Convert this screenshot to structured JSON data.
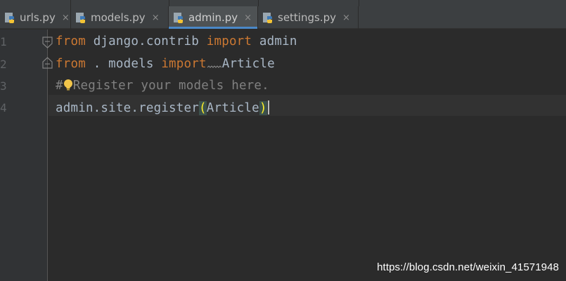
{
  "tabs": [
    {
      "label": "urls.py",
      "active": false
    },
    {
      "label": "models.py",
      "active": false
    },
    {
      "label": "admin.py",
      "active": true
    },
    {
      "label": "settings.py",
      "active": false
    }
  ],
  "tab_close_glyph": "×",
  "line_numbers": [
    "1",
    "2",
    "3",
    "4"
  ],
  "code": {
    "line1": {
      "kw1": "from",
      "mod": " django.contrib ",
      "kw2": "import",
      "name": " admin"
    },
    "line2": {
      "kw1": "from",
      "mod": " . models ",
      "kw2": "import",
      "name": "Article"
    },
    "line3": {
      "hash": "#",
      "comment": "Register your models here."
    },
    "line4": {
      "call": "admin.site.register",
      "open": "(",
      "arg": "Article",
      "close": ")"
    }
  },
  "icons": {
    "tab_icon": "python-file-icon",
    "gutter_icon": "fold-marker-icon",
    "hint_icon": "lightbulb-icon"
  },
  "colors": {
    "editor_bg": "#2b2b2b",
    "keyword": "#cc7832",
    "text": "#a9b7c6",
    "comment": "#808080",
    "active_tab_underline": "#4a88c7",
    "bracket_match": "#ffef28"
  },
  "watermark": "https://blog.csdn.net/weixin_41571948"
}
